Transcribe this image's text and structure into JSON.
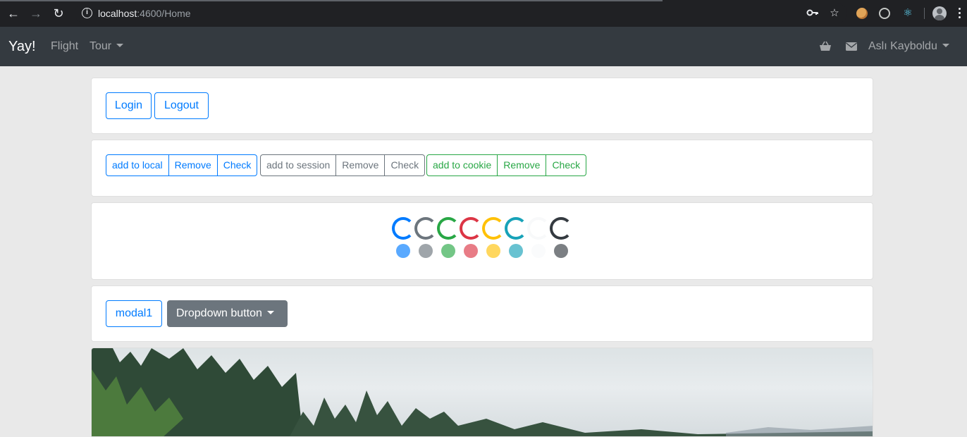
{
  "browser": {
    "url_host": "localhost",
    "url_port_path": ":4600/Home"
  },
  "navbar": {
    "brand": "Yay!",
    "links": [
      "Flight",
      "Tour"
    ],
    "user": "Aslı Kayboldu"
  },
  "auth": {
    "login_label": "Login",
    "logout_label": "Logout"
  },
  "storage": {
    "local": [
      "add to local",
      "Remove",
      "Check"
    ],
    "session": [
      "add to session",
      "Remove",
      "Check"
    ],
    "cookie": [
      "add to cookie",
      "Remove",
      "Check"
    ]
  },
  "spinners": {
    "colors": [
      "#007bff",
      "#6c757d",
      "#28a745",
      "#dc3545",
      "#ffc107",
      "#17a2b8",
      "#f8f9fa",
      "#343a40"
    ]
  },
  "actions": {
    "modal_label": "modal1",
    "dropdown_label": "Dropdown button"
  }
}
